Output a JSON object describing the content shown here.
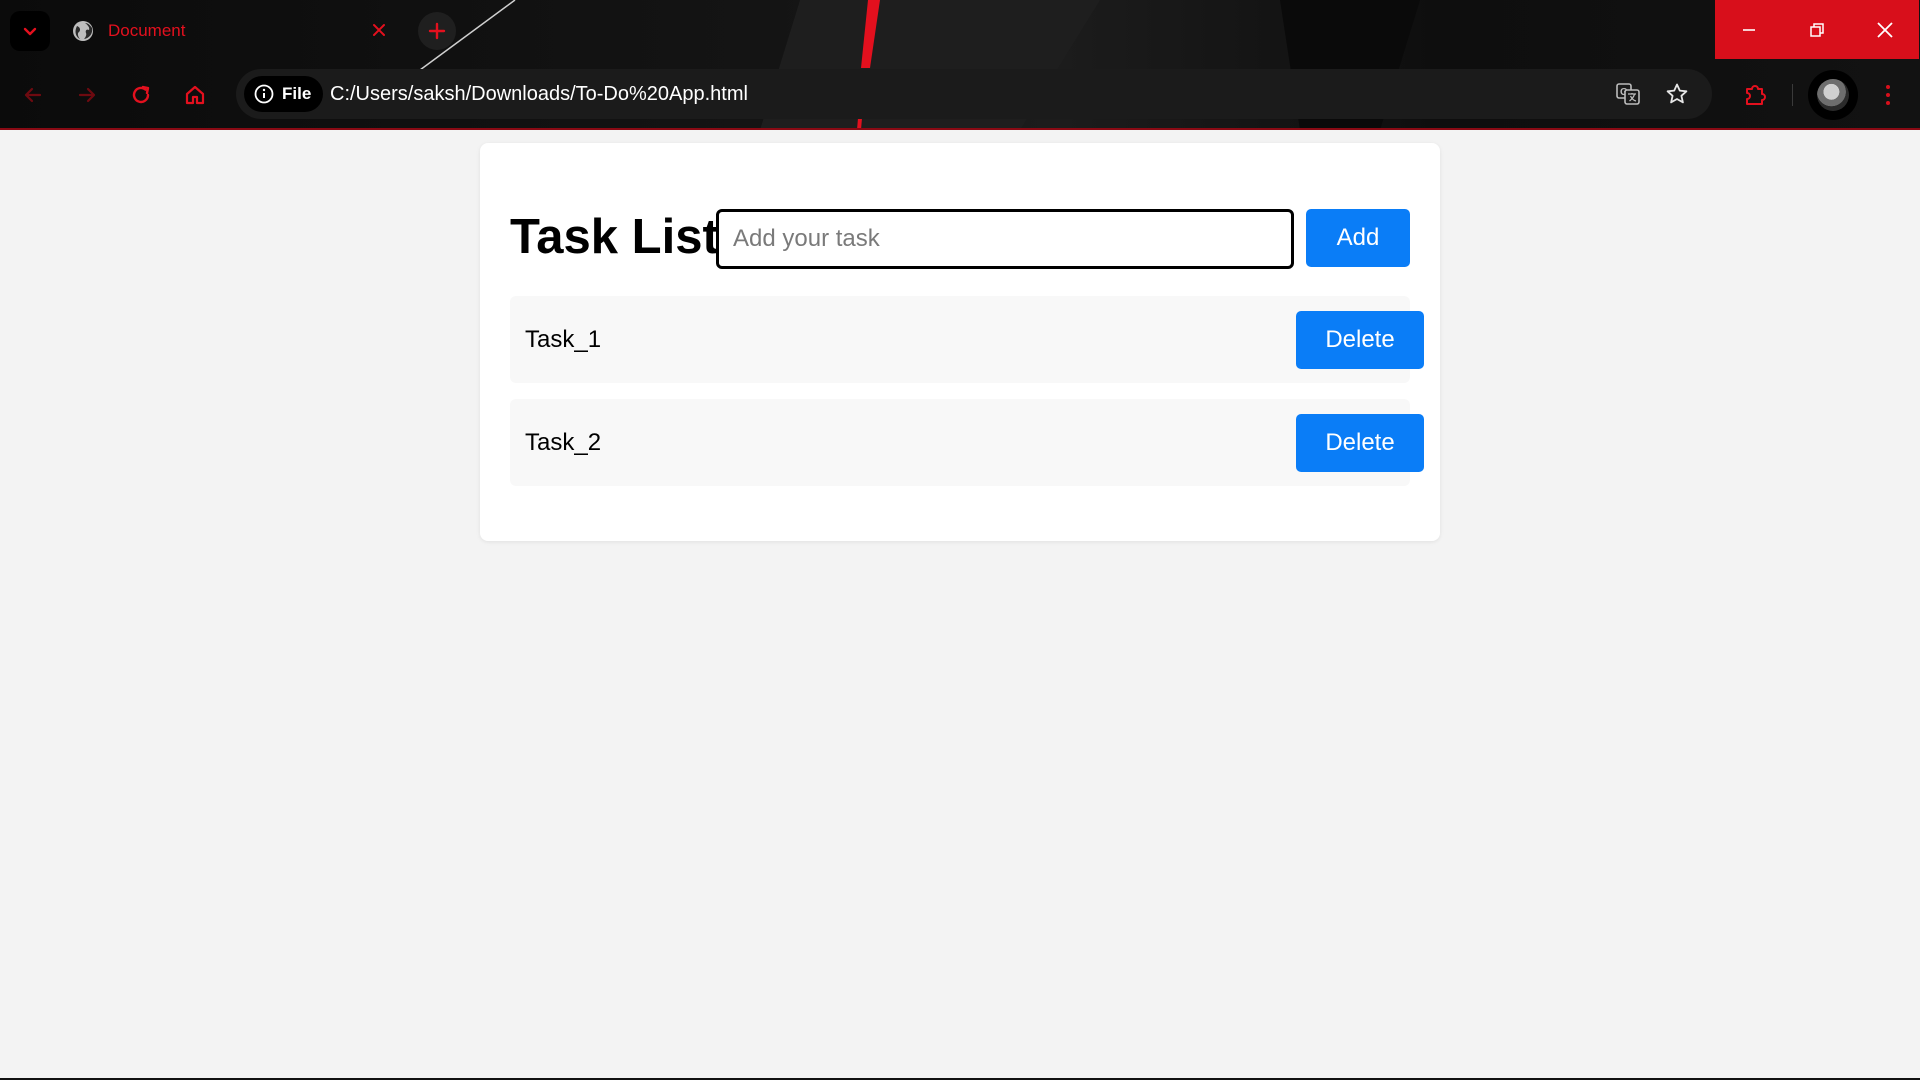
{
  "browser": {
    "tab": {
      "title": "Document"
    },
    "address": {
      "chip_label": "File",
      "url": "C:/Users/saksh/Downloads/To-Do%20App.html"
    },
    "icons": {
      "tab_search": "chevron-down-icon",
      "tab_favicon": "globe-icon",
      "tab_close": "close-icon",
      "new_tab": "plus-icon",
      "back": "arrow-left-icon",
      "forward": "arrow-right-icon",
      "reload": "reload-icon",
      "home": "home-icon",
      "site_info": "info-icon",
      "translate": "translate-icon",
      "bookmark": "star-icon",
      "extensions": "puzzle-icon",
      "profile": "avatar",
      "menu": "more-vertical-icon",
      "minimize": "minimize-icon",
      "restore": "restore-icon",
      "close_window": "close-icon"
    },
    "colors": {
      "accent": "#d80f1b",
      "chrome_bg": "#121212"
    }
  },
  "app": {
    "heading": "Task List",
    "input": {
      "placeholder": "Add your task",
      "value": ""
    },
    "add_label": "Add",
    "tasks": [
      {
        "text": "Task_1",
        "delete_label": "Delete"
      },
      {
        "text": "Task_2",
        "delete_label": "Delete"
      }
    ],
    "colors": {
      "button": "#0a7df7",
      "row_bg": "#f8f8f8",
      "page_bg": "#f3f3f3"
    }
  }
}
